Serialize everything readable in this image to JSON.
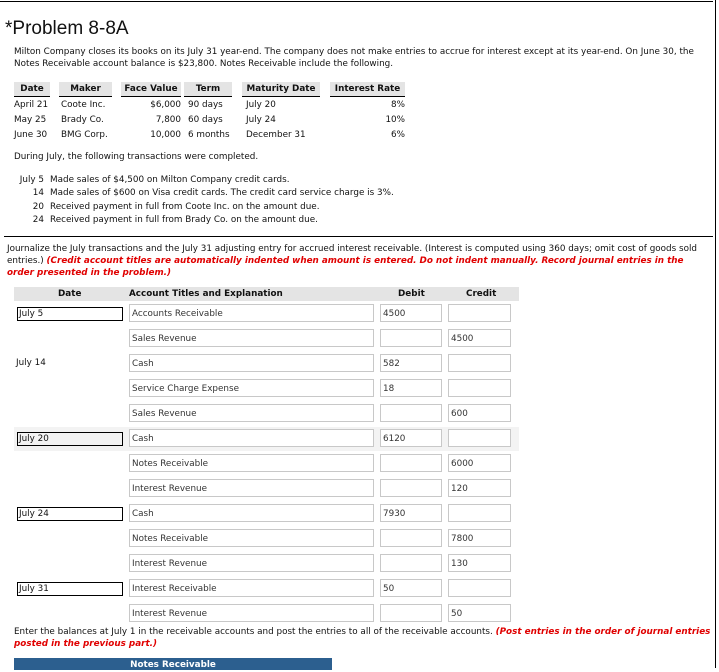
{
  "problem": {
    "title": "*Problem 8-8A",
    "intro": "Milton Company closes its books on its July 31 year-end. The company does not make entries to accrue for interest except at its year-end. On June 30, the Notes Receivable account balance is $23,800. Notes Receivable include the following."
  },
  "notes_table": {
    "headers": [
      "Date",
      "Maker",
      "Face Value",
      "Term",
      "Maturity Date",
      "Interest Rate"
    ],
    "rows": [
      {
        "date": "April 21",
        "maker": "Coote Inc.",
        "face": "$6,000",
        "term": "90 days",
        "maturity": "July 20",
        "rate": "8%"
      },
      {
        "date": "May 25",
        "maker": "Brady Co.",
        "face": "7,800",
        "term": "60 days",
        "maturity": "July 24",
        "rate": "10%"
      },
      {
        "date": "June 30",
        "maker": "BMG Corp.",
        "face": "10,000",
        "term": "6 months",
        "maturity": "December 31",
        "rate": "6%"
      }
    ]
  },
  "transactions": {
    "intro": "During July, the following transactions were completed.",
    "items": [
      {
        "day": "July 5",
        "text": "Made sales of $4,500 on Milton Company credit cards."
      },
      {
        "day": "14",
        "text": "Made sales of $600 on Visa credit cards. The credit card service charge is 3%."
      },
      {
        "day": "20",
        "text": "Received payment in full from Coote Inc. on the amount due."
      },
      {
        "day": "24",
        "text": "Received payment in full from Brady Co. on the amount due."
      }
    ]
  },
  "instructions": {
    "text": "Journalize the July transactions and the July 31 adjusting entry for accrued interest receivable. (Interest is computed using 360 days; omit cost of goods sold entries.) ",
    "note": "(Credit account titles are automatically indented when amount is entered. Do not indent manually. Record journal entries in the order presented in the problem.)"
  },
  "journal": {
    "headers": {
      "date": "Date",
      "account": "Account Titles and Explanation",
      "debit": "Debit",
      "credit": "Credit"
    },
    "rows": [
      {
        "date": "July 5",
        "date_boxed": true,
        "account": "Accounts Receivable",
        "debit": "4500",
        "credit": ""
      },
      {
        "date": "",
        "date_boxed": false,
        "account": "Sales Revenue",
        "debit": "",
        "credit": "4500"
      },
      {
        "date": "July 14",
        "date_boxed": false,
        "account": "Cash",
        "debit": "582",
        "credit": ""
      },
      {
        "date": "",
        "date_boxed": false,
        "account": "Service Charge Expense",
        "debit": "18",
        "credit": ""
      },
      {
        "date": "",
        "date_boxed": false,
        "account": "Sales Revenue",
        "debit": "",
        "credit": "600"
      },
      {
        "date": "July 20",
        "date_boxed": true,
        "account": "Cash",
        "debit": "6120",
        "credit": ""
      },
      {
        "date": "",
        "date_boxed": false,
        "account": "Notes Receivable",
        "debit": "",
        "credit": "6000"
      },
      {
        "date": "",
        "date_boxed": false,
        "account": "Interest Revenue",
        "debit": "",
        "credit": "120"
      },
      {
        "date": "July 24",
        "date_boxed": true,
        "account": "Cash",
        "debit": "7930",
        "credit": ""
      },
      {
        "date": "",
        "date_boxed": false,
        "account": "Notes Receivable",
        "debit": "",
        "credit": "7800"
      },
      {
        "date": "",
        "date_boxed": false,
        "account": "Interest Revenue",
        "debit": "",
        "credit": "130"
      },
      {
        "date": "July 31",
        "date_boxed": true,
        "account": "Interest Receivable",
        "debit": "50",
        "credit": ""
      },
      {
        "date": "",
        "date_boxed": false,
        "account": "Interest Revenue",
        "debit": "",
        "credit": "50"
      }
    ]
  },
  "posting": {
    "text": "Enter the balances at July 1 in the receivable accounts and post the entries to all of the receivable accounts. ",
    "note": "(Post entries in the order of journal entries posted in the previous part.)",
    "ledger_title": "Notes Receivable"
  }
}
